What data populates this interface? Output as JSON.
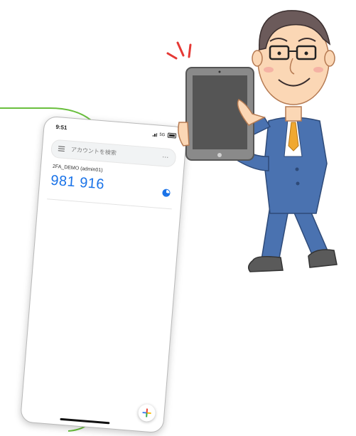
{
  "phone": {
    "status": {
      "time": "9:51",
      "network": "5G"
    },
    "search": {
      "placeholder": "アカウントを検索",
      "more": "..."
    },
    "accounts": [
      {
        "name": "2FA_DEMO (admin01)",
        "code": "981 916"
      }
    ],
    "fab": {
      "icon": "plus-icon"
    }
  },
  "colors": {
    "accent": "#1a73e8",
    "curve": "#6abf3e",
    "suit": "#4a72b0",
    "tie": "#f0a830",
    "tablet": "#8a8a8a",
    "skin": "#fbd7b5"
  }
}
